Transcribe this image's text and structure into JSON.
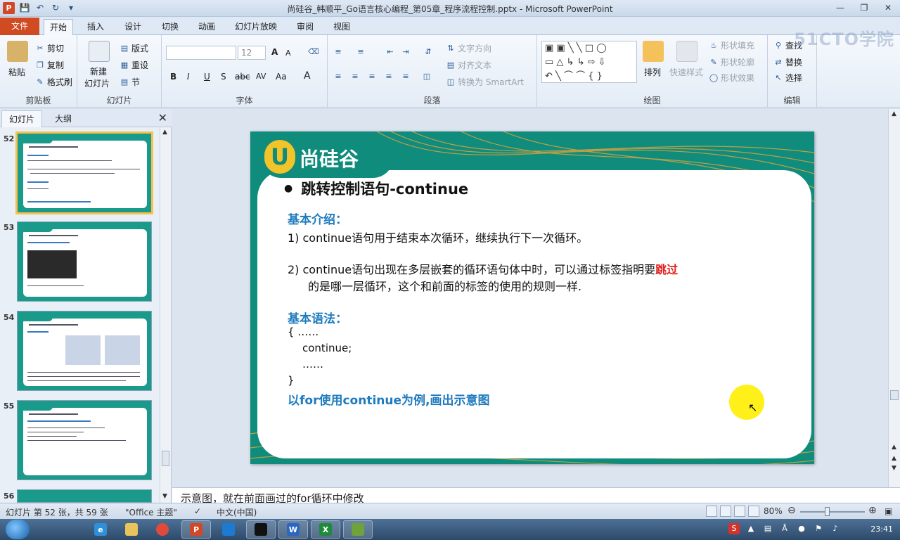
{
  "window": {
    "title": "尚硅谷_韩顺平_Go语言核心编程_第05章_程序流程控制.pptx - Microsoft PowerPoint",
    "app_letter": "P"
  },
  "ribbon_tabs": [
    {
      "label": "文件"
    },
    {
      "label": "开始"
    },
    {
      "label": "插入"
    },
    {
      "label": "设计"
    },
    {
      "label": "切换"
    },
    {
      "label": "动画"
    },
    {
      "label": "幻灯片放映"
    },
    {
      "label": "审阅"
    },
    {
      "label": "视图"
    }
  ],
  "ribbon": {
    "clipboard": {
      "paste": "粘贴",
      "cut": "剪切",
      "copy": "复制",
      "format_painter": "格式刷",
      "label": "剪贴板"
    },
    "slides": {
      "new_slide_1": "新建",
      "new_slide_2": "幻灯片",
      "layout": "版式",
      "reset": "重设",
      "section": "节",
      "label": "幻灯片"
    },
    "font": {
      "size": "12",
      "label": "字体",
      "grow": "A",
      "shrink": "A",
      "bold": "B",
      "italic": "I",
      "underline": "U",
      "shadow": "S",
      "strike": "abc",
      "spacing": "AV",
      "case": "Aa",
      "color": "A"
    },
    "paragraph": {
      "text_direction": "文字方向",
      "align_text": "对齐文本",
      "smartart": "转换为 SmartArt",
      "label": "段落"
    },
    "drawing": {
      "arrange": "排列",
      "quick_styles": "快速样式",
      "shape_fill": "形状填充",
      "shape_outline": "形状轮廓",
      "shape_effects": "形状效果",
      "label": "绘图"
    },
    "editing": {
      "find": "查找",
      "replace": "替换",
      "select": "选择",
      "label": "编辑"
    }
  },
  "watermark": "51CTO学院",
  "left_panel": {
    "tab_slides": "幻灯片",
    "tab_outline": "大纲",
    "close": "✕",
    "thumbnails": [
      {
        "number": "52",
        "selected": true
      },
      {
        "number": "53",
        "selected": false
      },
      {
        "number": "54",
        "selected": false
      },
      {
        "number": "55",
        "selected": false
      },
      {
        "number": "56",
        "selected": false
      }
    ]
  },
  "slide": {
    "logo_letter": "U",
    "logo_text": "尚硅谷",
    "bullet": "●",
    "heading": "跳转控制语句-continue",
    "intro_title": "基本介绍：",
    "point1": "1)  continue语句用于结束本次循环，继续执行下一次循环。",
    "point2_a": "2)  continue语句出现在多层嵌套的循环语句体中时，可以通过标签指明要",
    "point2_red": "跳过",
    "point2_b": "的是哪一层循环，这个和前面的标签的使用的规则一样.",
    "syntax_title": "基本语法：",
    "syntax_line1": "{    ……",
    "syntax_line2": "continue;",
    "syntax_line3": "……",
    "syntax_line4": "}",
    "example": "以for使用continue为例,画出示意图"
  },
  "notes": "示意图，就在前面画过的for循环中修改",
  "status_bar": {
    "slide_info": "幻灯片 第 52 张，共 59 张",
    "theme": "\"Office 主题\"",
    "language": "中文(中国)",
    "zoom": "80%",
    "zoom_level": 0.8
  },
  "taskbar": {
    "clock": "23:41"
  },
  "colors": {
    "accent_orange": "#d04a22",
    "teal": "#0f8c7c",
    "heading_blue": "#1f7bbf",
    "highlight_red": "#e0201b",
    "cursor_yellow": "#ffee00"
  }
}
